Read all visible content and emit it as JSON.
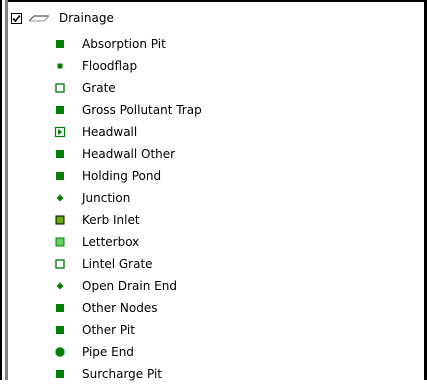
{
  "legend": {
    "layer": {
      "label": "Drainage",
      "checked": true
    },
    "items": [
      {
        "label": "Absorption Pit",
        "symbol": "filled-square"
      },
      {
        "label": "Floodflap",
        "symbol": "small-filled-square"
      },
      {
        "label": "Grate",
        "symbol": "hollow-square"
      },
      {
        "label": "Gross Pollutant Trap",
        "symbol": "filled-square"
      },
      {
        "label": "Headwall",
        "symbol": "headwall-square"
      },
      {
        "label": "Headwall Other",
        "symbol": "filled-square"
      },
      {
        "label": "Holding Pond",
        "symbol": "filled-square"
      },
      {
        "label": "Junction",
        "symbol": "diamond"
      },
      {
        "label": "Kerb Inlet",
        "symbol": "bordered-square"
      },
      {
        "label": "Letterbox",
        "symbol": "light-square"
      },
      {
        "label": "Lintel Grate",
        "symbol": "hollow-square"
      },
      {
        "label": "Open Drain End",
        "symbol": "diamond"
      },
      {
        "label": "Other Nodes",
        "symbol": "filled-square"
      },
      {
        "label": "Other Pit",
        "symbol": "filled-square"
      },
      {
        "label": "Pipe End",
        "symbol": "octagon"
      },
      {
        "label": "Surcharge Pit",
        "symbol": "filled-square"
      }
    ]
  },
  "colors": {
    "symbol_green": "#008000",
    "symbol_light_green": "#66cc66",
    "kerb_fill": "#66aa00"
  }
}
